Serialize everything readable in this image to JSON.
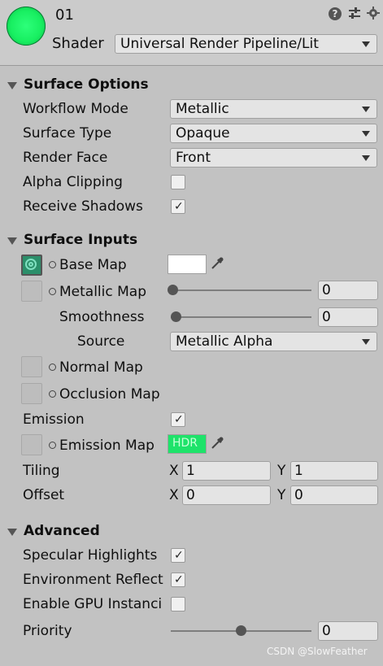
{
  "header": {
    "material_name": "01",
    "shader_label": "Shader",
    "shader_value": "Universal Render Pipeline/Lit",
    "preview_color": "#22f06a"
  },
  "toolbar_icons": [
    "help-icon",
    "presets-icon",
    "menu-icon"
  ],
  "surface_options": {
    "title": "Surface Options",
    "workflow_mode": {
      "label": "Workflow Mode",
      "value": "Metallic"
    },
    "surface_type": {
      "label": "Surface Type",
      "value": "Opaque"
    },
    "render_face": {
      "label": "Render Face",
      "value": "Front"
    },
    "alpha_clipping": {
      "label": "Alpha Clipping",
      "checked": false
    },
    "receive_shadows": {
      "label": "Receive Shadows",
      "checked": true
    }
  },
  "surface_inputs": {
    "title": "Surface Inputs",
    "base_map": {
      "label": "Base Map",
      "color": "#ffffff"
    },
    "metallic_map": {
      "label": "Metallic Map",
      "value": "0"
    },
    "smoothness": {
      "label": "Smoothness",
      "value": "0"
    },
    "source": {
      "label": "Source",
      "value": "Metallic Alpha"
    },
    "normal_map": {
      "label": "Normal Map"
    },
    "occlusion_map": {
      "label": "Occlusion Map"
    },
    "emission": {
      "label": "Emission",
      "checked": true
    },
    "emission_map": {
      "label": "Emission Map",
      "hdr_label": "HDR",
      "color": "#1ee36a"
    },
    "tiling": {
      "label": "Tiling",
      "x_label": "X",
      "x": "1",
      "y_label": "Y",
      "y": "1"
    },
    "offset": {
      "label": "Offset",
      "x_label": "X",
      "x": "0",
      "y_label": "Y",
      "y": "0"
    }
  },
  "advanced": {
    "title": "Advanced",
    "specular_highlights": {
      "label": "Specular Highlights",
      "checked": true
    },
    "environment_reflections": {
      "label": "Environment Reflect",
      "checked": true
    },
    "gpu_instancing": {
      "label": "Enable GPU Instanci",
      "checked": false
    },
    "priority": {
      "label": "Priority",
      "value": "0"
    }
  },
  "watermark": "CSDN @SlowFeather"
}
